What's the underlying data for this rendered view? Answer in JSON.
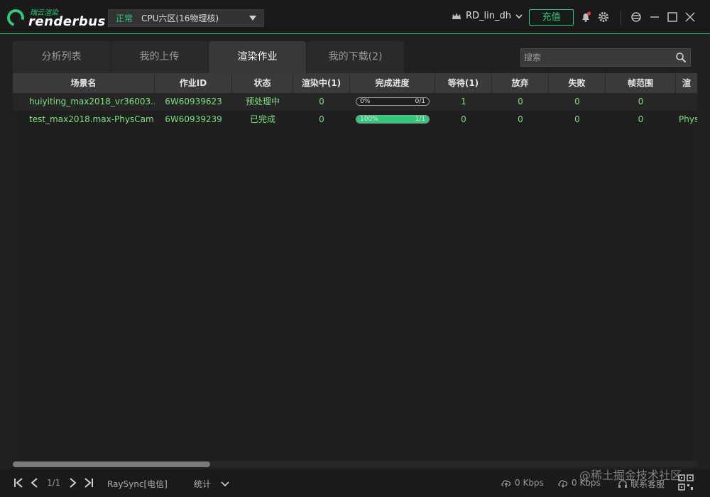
{
  "app": {
    "logo_cn": "瑞云渲染",
    "logo_en": "renderbus"
  },
  "zone": {
    "status": "正常",
    "name": "CPU六区(16物理核)"
  },
  "user": {
    "name": "RD_lin_dh",
    "recharge_label": "充值"
  },
  "tabs": [
    {
      "label": "分析列表",
      "active": false
    },
    {
      "label": "我的上传",
      "active": false
    },
    {
      "label": "渲染作业",
      "active": true
    },
    {
      "label": "我的下载(2)",
      "active": false
    }
  ],
  "search": {
    "placeholder": "搜索"
  },
  "table": {
    "columns": [
      "场景名",
      "作业ID",
      "状态",
      "渲染中(1)",
      "完成进度",
      "等待(1)",
      "放弃",
      "失败",
      "帧范围",
      "渲"
    ],
    "rows": [
      {
        "scene": "huiyiting_max2018_vr36003....",
        "job_id": "6W60939623",
        "status": "预处理中",
        "rendering": "0",
        "progress_pct": "0%",
        "progress_value": 0,
        "progress_count": "0/1",
        "waiting": "1",
        "abandoned": "0",
        "failed": "0",
        "frame_range": "0",
        "extra": ""
      },
      {
        "scene": "test_max2018.max-PhysCam...",
        "job_id": "6W60939239",
        "status": "已完成",
        "rendering": "0",
        "progress_pct": "100%",
        "progress_value": 1,
        "progress_count": "1/1",
        "waiting": "0",
        "abandoned": "0",
        "failed": "0",
        "frame_range": "0",
        "extra": "Phys"
      }
    ]
  },
  "footer": {
    "page": "1/1",
    "raysync": "RaySync[电信]",
    "stats": "统计",
    "upload_rate": "0 Kbps",
    "download_rate": "0 Kbps",
    "service": "联系客服"
  },
  "watermark": "@稀土掘金技术社区",
  "colors": {
    "accent": "#2ec97a",
    "text_green": "#7fe07f"
  }
}
